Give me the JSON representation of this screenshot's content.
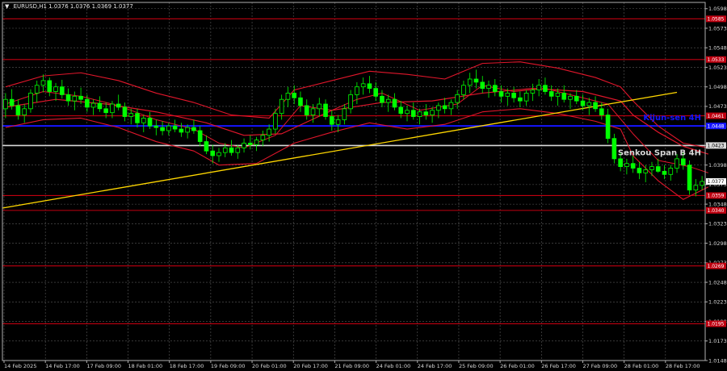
{
  "header": {
    "caret": "▼",
    "text": "EURUSD,H1  1.0376 1.0376 1.0369 1.0377"
  },
  "colors": {
    "background": "#000000",
    "grid": "#5a5a5a",
    "frame": "#b0b0b0",
    "candle": "#00ff00",
    "ichimoku": "#e0162b",
    "support_resistance": "#c00010",
    "kijun_4h": "#1414ff",
    "senkou_b_4h": "#d9d9d9",
    "trend": "#ffd700"
  },
  "chart_data": {
    "type": "candlestick",
    "symbol": "EURUSD",
    "timeframe": "H1",
    "ylim": [
      1.0148,
      1.0606
    ],
    "y_ticks": [
      1.0598,
      1.0573,
      1.0548,
      1.0523,
      1.0498,
      1.0473,
      1.0448,
      1.0423,
      1.0398,
      1.0373,
      1.0348,
      1.0323,
      1.0298,
      1.0273,
      1.0248,
      1.0223,
      1.0198,
      1.0173,
      1.0148
    ],
    "x_ticks": [
      "14 Feb 2025",
      "14 Feb 17:00",
      "17 Feb 09:00",
      "18 Feb 01:00",
      "18 Feb 17:00",
      "19 Feb 09:00",
      "20 Feb 01:00",
      "20 Feb 17:00",
      "21 Feb 09:00",
      "24 Feb 01:00",
      "24 Feb 17:00",
      "25 Feb 09:00",
      "26 Feb 01:00",
      "26 Feb 17:00",
      "27 Feb 09:00",
      "28 Feb 01:00",
      "28 Feb 17:00"
    ],
    "grid": true,
    "levels": [
      {
        "price": 1.0585,
        "tag": "1.0585"
      },
      {
        "price": 1.0533,
        "tag": "1.0533"
      },
      {
        "price": 1.0461,
        "tag": "1.0461"
      },
      {
        "price": 1.0359,
        "tag": "1.0359"
      },
      {
        "price": 1.034,
        "tag": "1.0340"
      },
      {
        "price": 1.0269,
        "tag": "1.0269"
      },
      {
        "price": 1.0195,
        "tag": "1.0195"
      }
    ],
    "kijun_4h": {
      "price": 1.0448,
      "tag": "1.0448",
      "label": "Kijun-sen 4H"
    },
    "senkou_b_4h": {
      "price": 1.0423,
      "tag": "1.0423",
      "label": "Senkou Span B 4H"
    },
    "current_price": {
      "price": 1.0377,
      "tag": "1.0377"
    },
    "trendline": {
      "from": {
        "x": 0,
        "y": 1.0343
      },
      "to": {
        "x": 107,
        "y": 1.0491
      }
    },
    "ohlc": [
      [
        1.047,
        1.049,
        1.0458,
        1.0482
      ],
      [
        1.0482,
        1.0495,
        1.0469,
        1.0474
      ],
      [
        1.0474,
        1.0482,
        1.0456,
        1.0462
      ],
      [
        1.0462,
        1.0476,
        1.0452,
        1.047
      ],
      [
        1.047,
        1.0495,
        1.0465,
        1.049
      ],
      [
        1.049,
        1.0506,
        1.0478,
        1.05
      ],
      [
        1.05,
        1.0514,
        1.0491,
        1.0506
      ],
      [
        1.0506,
        1.051,
        1.0486,
        1.0492
      ],
      [
        1.0492,
        1.0503,
        1.048,
        1.0498
      ],
      [
        1.0498,
        1.0507,
        1.0483,
        1.0488
      ],
      [
        1.0488,
        1.0496,
        1.0474,
        1.048
      ],
      [
        1.048,
        1.0492,
        1.0468,
        1.0486
      ],
      [
        1.0486,
        1.0497,
        1.0476,
        1.0482
      ],
      [
        1.0482,
        1.0488,
        1.0466,
        1.0472
      ],
      [
        1.0472,
        1.0482,
        1.0462,
        1.0477
      ],
      [
        1.0477,
        1.0486,
        1.0466,
        1.047
      ],
      [
        1.047,
        1.0478,
        1.0458,
        1.0465
      ],
      [
        1.0465,
        1.048,
        1.0458,
        1.0476
      ],
      [
        1.0476,
        1.0488,
        1.0468,
        1.0472
      ],
      [
        1.0472,
        1.0478,
        1.0454,
        1.046
      ],
      [
        1.046,
        1.047,
        1.045,
        1.0464
      ],
      [
        1.0464,
        1.047,
        1.0446,
        1.0452
      ],
      [
        1.0452,
        1.0462,
        1.044,
        1.0458
      ],
      [
        1.0458,
        1.0466,
        1.0444,
        1.0448
      ],
      [
        1.0448,
        1.0456,
        1.0436,
        1.0446
      ],
      [
        1.0446,
        1.0454,
        1.0436,
        1.0442
      ],
      [
        1.0442,
        1.0452,
        1.0436,
        1.0448
      ],
      [
        1.0448,
        1.0456,
        1.044,
        1.0444
      ],
      [
        1.0444,
        1.0452,
        1.0434,
        1.044
      ],
      [
        1.044,
        1.045,
        1.0432,
        1.0446
      ],
      [
        1.0446,
        1.0456,
        1.0438,
        1.0442
      ],
      [
        1.0442,
        1.0448,
        1.0422,
        1.0428
      ],
      [
        1.0428,
        1.0436,
        1.0412,
        1.0416
      ],
      [
        1.0416,
        1.0424,
        1.04,
        1.041
      ],
      [
        1.041,
        1.042,
        1.0402,
        1.0414
      ],
      [
        1.0414,
        1.0426,
        1.0408,
        1.042
      ],
      [
        1.042,
        1.043,
        1.041,
        1.0414
      ],
      [
        1.0414,
        1.0424,
        1.0406,
        1.042
      ],
      [
        1.042,
        1.0432,
        1.0414,
        1.0426
      ],
      [
        1.0426,
        1.0436,
        1.0418,
        1.0424
      ],
      [
        1.0424,
        1.0434,
        1.0416,
        1.043
      ],
      [
        1.043,
        1.0442,
        1.0422,
        1.0436
      ],
      [
        1.0436,
        1.045,
        1.0428,
        1.0444
      ],
      [
        1.0444,
        1.047,
        1.0438,
        1.0464
      ],
      [
        1.0464,
        1.0488,
        1.0456,
        1.0482
      ],
      [
        1.0482,
        1.0498,
        1.0472,
        1.049
      ],
      [
        1.049,
        1.05,
        1.0476,
        1.0484
      ],
      [
        1.0484,
        1.0492,
        1.0466,
        1.0474
      ],
      [
        1.0474,
        1.0482,
        1.0456,
        1.0462
      ],
      [
        1.0462,
        1.0476,
        1.0452,
        1.047
      ],
      [
        1.047,
        1.0484,
        1.046,
        1.0476
      ],
      [
        1.0476,
        1.0482,
        1.0456,
        1.046
      ],
      [
        1.046,
        1.0468,
        1.0442,
        1.045
      ],
      [
        1.045,
        1.0462,
        1.044,
        1.0456
      ],
      [
        1.0456,
        1.0476,
        1.045,
        1.047
      ],
      [
        1.047,
        1.0494,
        1.0464,
        1.0488
      ],
      [
        1.0488,
        1.0504,
        1.0476,
        1.0498
      ],
      [
        1.0498,
        1.051,
        1.0488,
        1.0502
      ],
      [
        1.0502,
        1.0512,
        1.049,
        1.0496
      ],
      [
        1.0496,
        1.0504,
        1.048,
        1.0486
      ],
      [
        1.0486,
        1.0494,
        1.0472,
        1.0478
      ],
      [
        1.0478,
        1.0488,
        1.0466,
        1.0482
      ],
      [
        1.0482,
        1.049,
        1.0468,
        1.0472
      ],
      [
        1.0472,
        1.048,
        1.0458,
        1.0464
      ],
      [
        1.0464,
        1.0474,
        1.0454,
        1.0468
      ],
      [
        1.0468,
        1.0478,
        1.0456,
        1.046
      ],
      [
        1.046,
        1.047,
        1.045,
        1.0466
      ],
      [
        1.0466,
        1.0476,
        1.0456,
        1.0462
      ],
      [
        1.0462,
        1.0472,
        1.0452,
        1.0468
      ],
      [
        1.0468,
        1.0478,
        1.0458,
        1.0474
      ],
      [
        1.0474,
        1.0484,
        1.0464,
        1.047
      ],
      [
        1.047,
        1.0482,
        1.0462,
        1.0478
      ],
      [
        1.0478,
        1.0494,
        1.047,
        1.0488
      ],
      [
        1.0488,
        1.0506,
        1.0482,
        1.05
      ],
      [
        1.05,
        1.0516,
        1.049,
        1.0508
      ],
      [
        1.0508,
        1.052,
        1.0496,
        1.0504
      ],
      [
        1.0504,
        1.0512,
        1.049,
        1.0496
      ],
      [
        1.0496,
        1.0506,
        1.0484,
        1.05
      ],
      [
        1.05,
        1.0508,
        1.0486,
        1.0492
      ],
      [
        1.0492,
        1.05,
        1.0478,
        1.0486
      ],
      [
        1.0486,
        1.0496,
        1.0474,
        1.049
      ],
      [
        1.049,
        1.0498,
        1.0478,
        1.0484
      ],
      [
        1.0484,
        1.0492,
        1.0472,
        1.048
      ],
      [
        1.048,
        1.0494,
        1.0474,
        1.049
      ],
      [
        1.049,
        1.0502,
        1.048,
        1.0494
      ],
      [
        1.0494,
        1.0508,
        1.0486,
        1.05
      ],
      [
        1.05,
        1.051,
        1.0488,
        1.0492
      ],
      [
        1.0492,
        1.05,
        1.048,
        1.0486
      ],
      [
        1.0486,
        1.0496,
        1.0474,
        1.049
      ],
      [
        1.049,
        1.05,
        1.0478,
        1.0482
      ],
      [
        1.0482,
        1.049,
        1.047,
        1.0486
      ],
      [
        1.0486,
        1.0494,
        1.0476,
        1.048
      ],
      [
        1.048,
        1.0488,
        1.0468,
        1.0474
      ],
      [
        1.0474,
        1.0484,
        1.0462,
        1.0478
      ],
      [
        1.0478,
        1.0486,
        1.0466,
        1.047
      ],
      [
        1.047,
        1.0478,
        1.0456,
        1.0462
      ],
      [
        1.0462,
        1.047,
        1.0426,
        1.0432
      ],
      [
        1.0432,
        1.0438,
        1.04,
        1.0406
      ],
      [
        1.0406,
        1.0414,
        1.039,
        1.0396
      ],
      [
        1.0396,
        1.0406,
        1.0386,
        1.04
      ],
      [
        1.04,
        1.041,
        1.0388,
        1.0394
      ],
      [
        1.0394,
        1.0402,
        1.038,
        1.0388
      ],
      [
        1.0388,
        1.0398,
        1.0376,
        1.0392
      ],
      [
        1.0392,
        1.0402,
        1.0384,
        1.0396
      ],
      [
        1.0396,
        1.0406,
        1.0388,
        1.039
      ],
      [
        1.039,
        1.0398,
        1.038,
        1.0386
      ],
      [
        1.0386,
        1.0398,
        1.0378,
        1.0394
      ],
      [
        1.0394,
        1.0412,
        1.0388,
        1.0406
      ],
      [
        1.0406,
        1.0414,
        1.0392,
        1.0398
      ],
      [
        1.0398,
        1.0404,
        1.036,
        1.0366
      ],
      [
        1.0366,
        1.038,
        1.0358,
        1.0372
      ],
      [
        1.0372,
        1.0384,
        1.0366,
        1.0377
      ]
    ],
    "tenkan": [
      [
        0,
        1.0476
      ],
      [
        6,
        1.0492
      ],
      [
        12,
        1.0486
      ],
      [
        18,
        1.0474
      ],
      [
        24,
        1.0456
      ],
      [
        30,
        1.0444
      ],
      [
        34,
        1.0426
      ],
      [
        38,
        1.042
      ],
      [
        43,
        1.0436
      ],
      [
        47,
        1.0474
      ],
      [
        52,
        1.0468
      ],
      [
        56,
        1.0482
      ],
      [
        60,
        1.049
      ],
      [
        66,
        1.0468
      ],
      [
        72,
        1.0476
      ],
      [
        76,
        1.05
      ],
      [
        81,
        1.0492
      ],
      [
        86,
        1.0496
      ],
      [
        91,
        1.0486
      ],
      [
        96,
        1.0476
      ],
      [
        100,
        1.0438
      ],
      [
        104,
        1.0404
      ],
      [
        109,
        1.0396
      ],
      [
        112,
        1.0388
      ]
    ],
    "kijun": [
      [
        0,
        1.0472
      ],
      [
        8,
        1.0482
      ],
      [
        16,
        1.0476
      ],
      [
        24,
        1.0466
      ],
      [
        32,
        1.0452
      ],
      [
        38,
        1.0436
      ],
      [
        44,
        1.0438
      ],
      [
        52,
        1.0468
      ],
      [
        60,
        1.0478
      ],
      [
        68,
        1.048
      ],
      [
        76,
        1.049
      ],
      [
        84,
        1.0496
      ],
      [
        92,
        1.0492
      ],
      [
        98,
        1.048
      ],
      [
        100,
        1.0462
      ],
      [
        104,
        1.044
      ],
      [
        108,
        1.0422
      ],
      [
        112,
        1.0412
      ]
    ],
    "bands_upper": [
      [
        0,
        1.0498
      ],
      [
        6,
        1.0512
      ],
      [
        12,
        1.0516
      ],
      [
        18,
        1.0506
      ],
      [
        24,
        1.049
      ],
      [
        30,
        1.0478
      ],
      [
        36,
        1.0462
      ],
      [
        42,
        1.0458
      ],
      [
        46,
        1.0494
      ],
      [
        52,
        1.0506
      ],
      [
        58,
        1.0518
      ],
      [
        64,
        1.0514
      ],
      [
        70,
        1.0508
      ],
      [
        76,
        1.0528
      ],
      [
        82,
        1.053
      ],
      [
        88,
        1.0522
      ],
      [
        94,
        1.051
      ],
      [
        98,
        1.0498
      ],
      [
        100,
        1.048
      ],
      [
        104,
        1.0448
      ],
      [
        108,
        1.0426
      ],
      [
        112,
        1.042
      ]
    ],
    "bands_lower": [
      [
        0,
        1.0446
      ],
      [
        6,
        1.0456
      ],
      [
        12,
        1.0458
      ],
      [
        18,
        1.0446
      ],
      [
        24,
        1.0428
      ],
      [
        30,
        1.0416
      ],
      [
        34,
        1.0398
      ],
      [
        40,
        1.04
      ],
      [
        46,
        1.0426
      ],
      [
        52,
        1.044
      ],
      [
        58,
        1.0452
      ],
      [
        64,
        1.0444
      ],
      [
        70,
        1.045
      ],
      [
        76,
        1.0466
      ],
      [
        82,
        1.047
      ],
      [
        88,
        1.0464
      ],
      [
        94,
        1.0454
      ],
      [
        98,
        1.0444
      ],
      [
        100,
        1.041
      ],
      [
        104,
        1.0378
      ],
      [
        108,
        1.0354
      ],
      [
        112,
        1.037
      ]
    ]
  }
}
